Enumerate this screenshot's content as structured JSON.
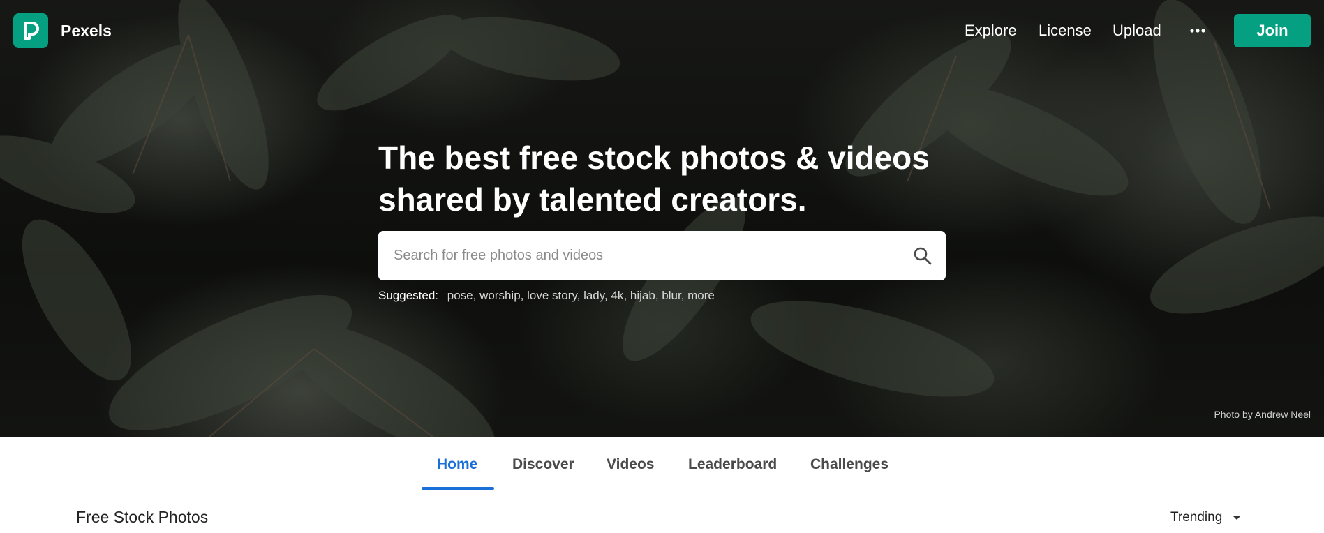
{
  "brand": {
    "name": "Pexels"
  },
  "nav": {
    "links": [
      "Explore",
      "License",
      "Upload"
    ],
    "join_label": "Join"
  },
  "hero": {
    "headline_line1": "The best free stock photos & videos",
    "headline_line2": "shared by talented creators.",
    "search_placeholder": "Search for free photos and videos",
    "suggested_label": "Suggested:",
    "suggested_tags": [
      "pose",
      "worship",
      "love story",
      "lady",
      "4k",
      "hijab",
      "blur",
      "more"
    ],
    "photo_credit": "Photo by Andrew Neel"
  },
  "tabs": {
    "items": [
      "Home",
      "Discover",
      "Videos",
      "Leaderboard",
      "Challenges"
    ],
    "active": "Home"
  },
  "content": {
    "section_title": "Free Stock Photos",
    "sort_value": "Trending"
  },
  "colors": {
    "brand_green": "#05a081",
    "tab_active_blue": "#1a6fd9"
  },
  "icons": [
    "pexels-logo-icon",
    "more-dots-icon",
    "search-icon",
    "chevron-down-icon"
  ]
}
